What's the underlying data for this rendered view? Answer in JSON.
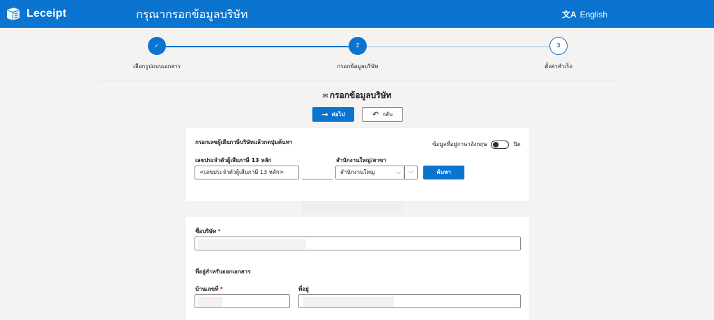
{
  "header": {
    "brand": "Leceipt",
    "title": "กรุณากรอกข้อมูลบริษัท",
    "language": "English",
    "colors": {
      "bar": "#0b73d0",
      "text": "#ffffff"
    }
  },
  "stepper": {
    "steps": [
      {
        "number": "✓",
        "label": "เลือกรูปแบบเอกสาร",
        "state": "done"
      },
      {
        "number": "2",
        "label": "กรอกข้อมูลบริษัท",
        "state": "current"
      },
      {
        "number": "3",
        "label": "ตั้งค่าสำเร็จ",
        "state": "todo"
      }
    ]
  },
  "section": {
    "icon": "✉",
    "title": "กรอกข้อมูลบริษัท"
  },
  "actions": {
    "next_label": "ต่อไป",
    "next_icon": "→",
    "back_label": "กลับ",
    "back_icon": "↶"
  },
  "search_panel": {
    "instruction": "กรอกเลขผู้เสียภาษีบริษัทแล้วกดปุ่มค้นหา",
    "english_toggle_label": "ข้อมูลที่อยู่ภาษาอังกฤษ",
    "english_toggle_state": "ปิด",
    "tax_id_label": "เลขประจำตัวผู้เสียภาษี 13 หลัก",
    "tax_id_value": "<เลขประจำตัวผู้เสียภาษี 13 หลัก>",
    "branch_label": "สำนักงานใหญ่/สาขา",
    "branch_value": "สำนักงานใหญ่",
    "search_label": "ค้นหา"
  },
  "company_form": {
    "company_name_label": "ชื่อบริษัท",
    "required_mark": "*",
    "address_heading": "ที่อยู่สำหรับออกเอกสาร",
    "house_no_label": "บ้านเลขที่",
    "address_label": "ที่อยู่"
  }
}
